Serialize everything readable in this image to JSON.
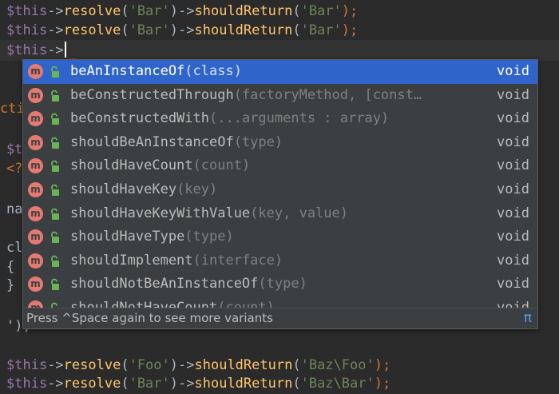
{
  "editor": {
    "line1": {
      "var": "$this",
      "arrow1": "->",
      "m1": "resolve",
      "open1": "(",
      "s1": "'Bar'",
      "close1": ")",
      "arrow2": "->",
      "m2": "shouldReturn",
      "open2": "(",
      "s2": "'Bar'",
      "close2": ");"
    },
    "line2": {
      "var": "$this",
      "arrow1": "->",
      "m1": "resolve",
      "open1": "(",
      "s1": "'Bar'",
      "close1": ")",
      "arrow2": "->",
      "m2": "shouldReturn",
      "open2": "(",
      "s2": "'Bar'",
      "close2": ");"
    },
    "line3": {
      "var": "$this",
      "arrow1": "->"
    },
    "left_fragments": [
      "cti",
      "$t",
      "<?",
      "na",
      "cl",
      "{",
      "}",
      "');"
    ],
    "line_foo": {
      "var": "$this",
      "arrow1": "->",
      "m1": "resolve",
      "open1": "(",
      "s1": "'Foo'",
      "close1": ")",
      "arrow2": "->",
      "m2": "shouldReturn",
      "open2": "(",
      "s2": "'Baz\\Foo'",
      "close2": ");"
    },
    "line_bar": {
      "var": "$this",
      "arrow1": "->",
      "m1": "resolve",
      "open1": "(",
      "s1": "'Bar'",
      "close1": ")",
      "arrow2": "->",
      "m2": "shouldReturn",
      "open2": "(",
      "s2": "'Baz\\Bar'",
      "close2": ");"
    }
  },
  "completion": {
    "items": [
      {
        "icon": "m",
        "name": "beAnInstanceOf",
        "params": "(class)",
        "type": "void"
      },
      {
        "icon": "m",
        "name": "beConstructedThrough",
        "params": "(factoryMethod, [const…",
        "type": "void"
      },
      {
        "icon": "m",
        "name": "beConstructedWith",
        "params": "(...arguments : array)",
        "type": "void"
      },
      {
        "icon": "m",
        "name": "shouldBeAnInstanceOf",
        "params": "(type)",
        "type": "void"
      },
      {
        "icon": "m",
        "name": "shouldHaveCount",
        "params": "(count)",
        "type": "void"
      },
      {
        "icon": "m",
        "name": "shouldHaveKey",
        "params": "(key)",
        "type": "void"
      },
      {
        "icon": "m",
        "name": "shouldHaveKeyWithValue",
        "params": "(key, value)",
        "type": "void"
      },
      {
        "icon": "m",
        "name": "shouldHaveType",
        "params": "(type)",
        "type": "void"
      },
      {
        "icon": "m",
        "name": "shouldImplement",
        "params": "(interface)",
        "type": "void"
      },
      {
        "icon": "m",
        "name": "shouldNotBeAnInstanceOf",
        "params": "(type)",
        "type": "void"
      },
      {
        "icon": "m",
        "name": "shouldNotHaveCount",
        "params": "(count)",
        "type": "void"
      }
    ],
    "footer_hint": "Press ^Space again to see more variants",
    "footer_icon": "π"
  },
  "colors": {
    "background": "#2b2b2b",
    "popup_background": "#3c3f41",
    "selection": "#2f65ca",
    "method_icon": "#e57a72",
    "lock_icon": "#6bb455"
  }
}
